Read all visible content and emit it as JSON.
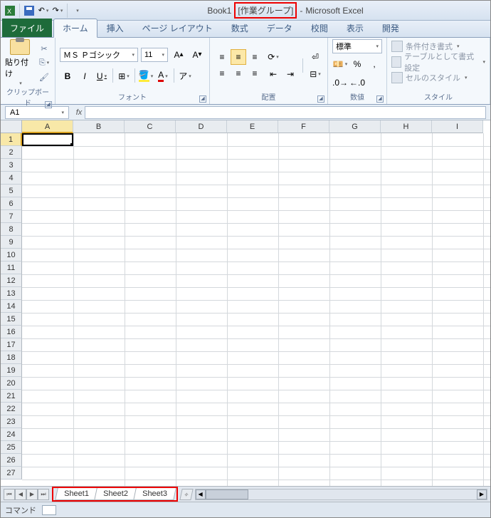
{
  "title": {
    "book": "Book1",
    "group": "[作業グループ]",
    "app": "Microsoft Excel"
  },
  "tabs": {
    "file": "ファイル",
    "home": "ホーム",
    "insert": "挿入",
    "layout": "ページ レイアウト",
    "formula": "数式",
    "data": "データ",
    "review": "校閲",
    "view": "表示",
    "dev": "開発"
  },
  "ribbon": {
    "clipboard": {
      "paste": "貼り付け",
      "label": "クリップボード"
    },
    "font": {
      "name": "ＭＳ Ｐゴシック",
      "size": "11",
      "label": "フォント"
    },
    "align": {
      "label": "配置"
    },
    "number": {
      "format": "標準",
      "label": "数値"
    },
    "styles": {
      "cond": "条件付き書式",
      "table": "テーブルとして書式設定",
      "cell": "セルのスタイル",
      "label": "スタイル"
    }
  },
  "namebox": "A1",
  "columns": [
    "A",
    "B",
    "C",
    "D",
    "E",
    "F",
    "G",
    "H",
    "I"
  ],
  "rows": [
    "1",
    "2",
    "3",
    "4",
    "5",
    "6",
    "7",
    "8",
    "9",
    "10",
    "11",
    "12",
    "13",
    "14",
    "15",
    "16",
    "17",
    "18",
    "19",
    "20",
    "21",
    "22",
    "23",
    "24",
    "25",
    "26",
    "27"
  ],
  "sheets": [
    "Sheet1",
    "Sheet2",
    "Sheet3"
  ],
  "status": "コマンド"
}
